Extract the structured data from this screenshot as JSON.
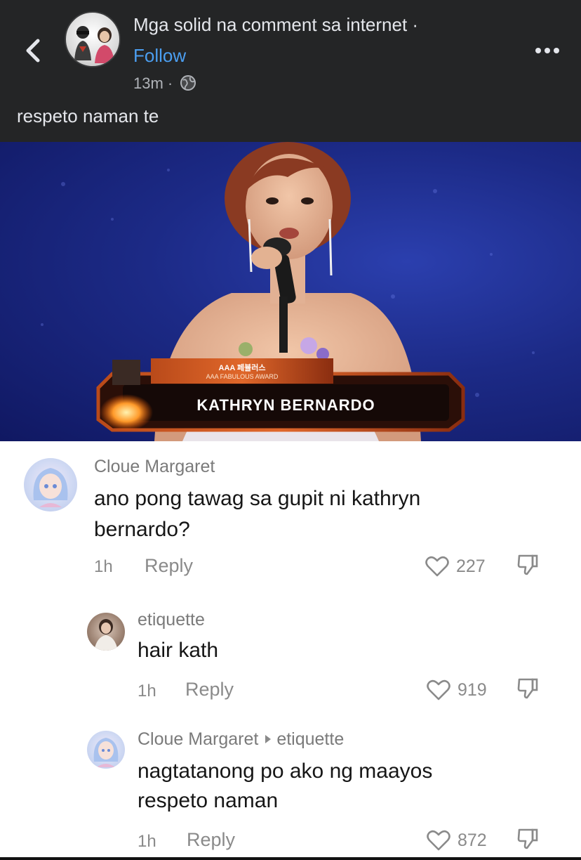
{
  "post": {
    "page_name": "Mga solid na comment sa internet ·",
    "follow_label": "Follow",
    "time": "13m ·",
    "caption": "respeto naman te"
  },
  "photo": {
    "award_line1": "AAA 페뷸러스",
    "award_line2": "AAA FABULOUS AWARD",
    "name_banner": "KATHRYN BERNARDO"
  },
  "comments": [
    {
      "author": "Cloue Margaret",
      "text_line1": "ano pong tawag sa gupit ni kathryn",
      "text_line2": "bernardo?",
      "time": "1h",
      "reply_label": "Reply",
      "likes": "227"
    },
    {
      "author": "etiquette",
      "text_line1": "hair kath",
      "time": "1h",
      "reply_label": "Reply",
      "likes": "919"
    },
    {
      "author": "Cloue Margaret",
      "reply_to": "etiquette",
      "text_line1": "nagtatanong po ako ng maayos",
      "text_line2": "respeto naman",
      "time": "1h",
      "reply_label": "Reply",
      "likes": "872"
    }
  ],
  "icons": {
    "back": "back-arrow-icon",
    "more": "more-options-icon",
    "privacy": "globe-icon",
    "like": "heart-icon",
    "dislike": "dislike-icon"
  },
  "colors": {
    "header_bg": "#242526",
    "follow_link": "#4b9ef0",
    "comments_bg": "#ffffff",
    "stage_blue": "#1c2a86"
  }
}
